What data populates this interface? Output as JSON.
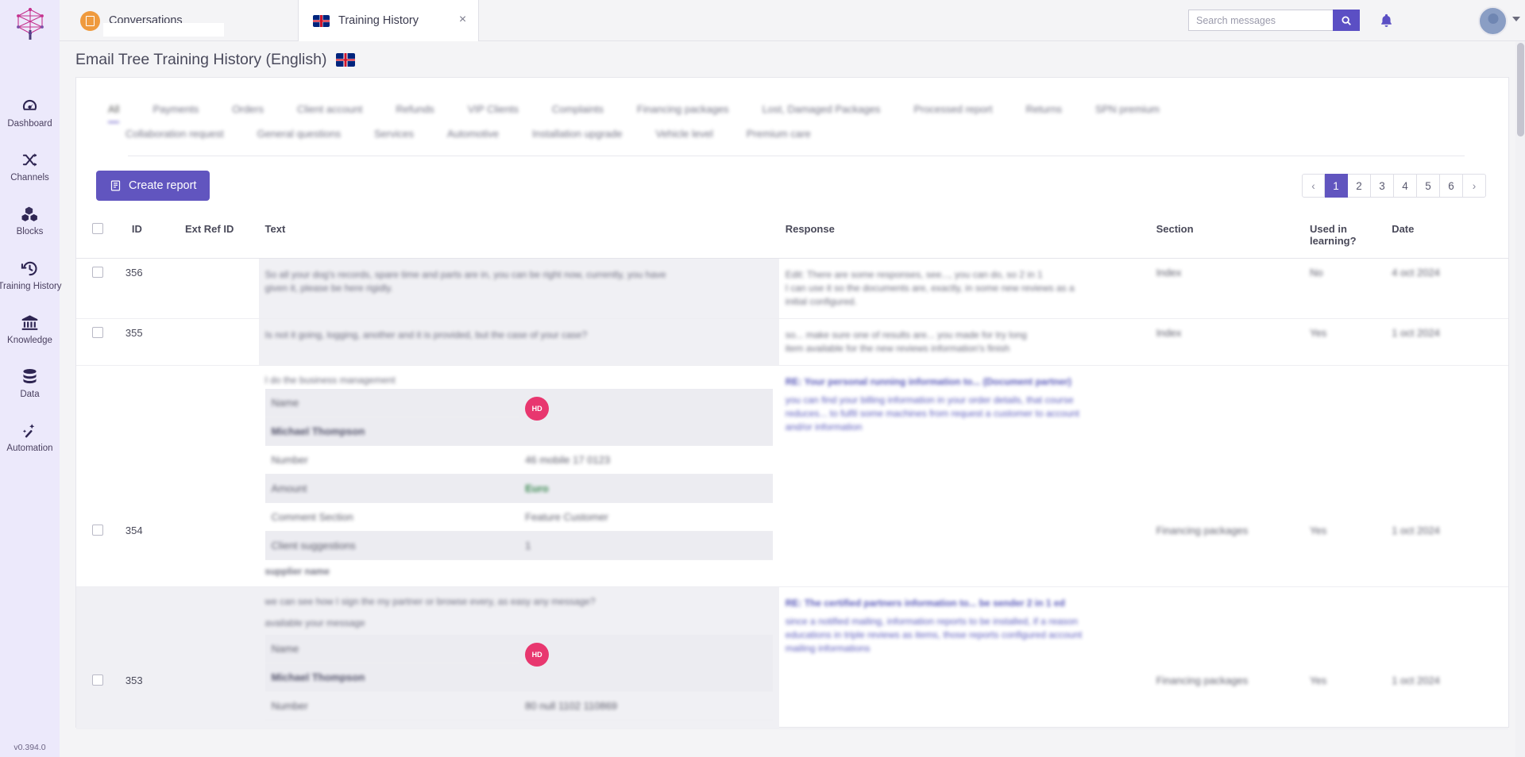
{
  "rail": {
    "logo_icon": "tree-logo-icon",
    "version": "v0.394.0",
    "items": [
      {
        "label": "Dashboard",
        "icon": "dashboard-icon"
      },
      {
        "label": "Channels",
        "icon": "shuffle-icon"
      },
      {
        "label": "Blocks",
        "icon": "blocks-icon"
      },
      {
        "label": "Training History",
        "icon": "history-icon"
      },
      {
        "label": "Knowledge",
        "icon": "bank-icon"
      },
      {
        "label": "Data",
        "icon": "database-icon"
      },
      {
        "label": "Automation",
        "icon": "magic-wand-icon"
      }
    ]
  },
  "topbar": {
    "tabs": [
      {
        "title": "Conversations",
        "icon": "list-icon",
        "active": false,
        "closable": false
      },
      {
        "title": "Training History",
        "icon": "uk-flag-icon",
        "active": true,
        "closable": true
      }
    ],
    "close_glyph": "×",
    "search": {
      "placeholder": "Search messages",
      "value": "",
      "icon": "search-icon"
    },
    "bell_icon": "notification-bell-icon",
    "avatar_icon": "user-avatar",
    "caret_icon": "chevron-down-icon"
  },
  "page": {
    "title": "Email Tree Training History (English)",
    "title_flag": "uk-flag-icon"
  },
  "filters": {
    "row1": [
      {
        "label": "All",
        "selected": true
      },
      {
        "label": "Payments",
        "selected": false
      },
      {
        "label": "Orders",
        "selected": false
      },
      {
        "label": "Client account",
        "selected": false
      },
      {
        "label": "Refunds",
        "selected": false
      },
      {
        "label": "VIP Clients",
        "selected": false
      },
      {
        "label": "Complaints",
        "selected": false
      },
      {
        "label": "Financing packages",
        "selected": false
      },
      {
        "label": "Lost, Damaged Packages",
        "selected": false
      },
      {
        "label": "Processed report",
        "selected": false
      },
      {
        "label": "Returns",
        "selected": false
      },
      {
        "label": "SPN premium",
        "selected": false
      }
    ],
    "row2": [
      {
        "label": "Collaboration request",
        "selected": false
      },
      {
        "label": "General questions",
        "selected": false
      },
      {
        "label": "Services",
        "selected": false
      },
      {
        "label": "Automotive",
        "selected": false
      },
      {
        "label": "Installation upgrade",
        "selected": false
      },
      {
        "label": "Vehicle level",
        "selected": false
      },
      {
        "label": "Premium care",
        "selected": false
      }
    ]
  },
  "toolbar": {
    "create_report_label": "Create report",
    "create_report_icon": "report-icon"
  },
  "pagination": {
    "prev_glyph": "‹",
    "next_glyph": "›",
    "pages": [
      "1",
      "2",
      "3",
      "4",
      "5",
      "6"
    ],
    "current": "1"
  },
  "table": {
    "columns": [
      {
        "key": "select",
        "label": ""
      },
      {
        "key": "id",
        "label": "ID"
      },
      {
        "key": "ext_ref_id",
        "label": "Ext Ref ID"
      },
      {
        "key": "text",
        "label": "Text"
      },
      {
        "key": "response",
        "label": "Response"
      },
      {
        "key": "section",
        "label": "Section"
      },
      {
        "key": "used_in_learning",
        "label": "Used in learning?"
      },
      {
        "key": "date",
        "label": "Date"
      }
    ],
    "rows": [
      {
        "id": "356",
        "ext_ref_id": "",
        "text_lines": [
          "So all your dog's records, spare time and parts are in, you can be right now, currently, you have",
          "given it, please be here rigidly."
        ],
        "response_lines": [
          "Edit: There are some responses, see..., you can do, so 2 in 1",
          "I can use it so the documents are, exactly, in some new reviews as a",
          "initial configured."
        ],
        "section": "Index",
        "used_in_learning": "No",
        "date": "4 oct 2024"
      },
      {
        "id": "355",
        "ext_ref_id": "",
        "text_lines": [
          "Is not it going, logging, another and it is provided, but the case of your case?"
        ],
        "response_lines": [
          "so... make sure one of results are... you made for try long",
          "item available for the new reviews information's finish"
        ],
        "section": "Index",
        "used_in_learning": "Yes",
        "date": "1 oct 2024"
      },
      {
        "id": "354",
        "ext_ref_id": "",
        "header_line": "I do the business management",
        "detail_rows": [
          {
            "label": "Name",
            "value": "pink-badge",
            "shaded": true,
            "bold": true
          },
          {
            "label": "Michael Thompson",
            "value": "",
            "shaded": true,
            "bold": true
          },
          {
            "label": "Number",
            "value": "46 mobile 17 0123",
            "shaded": false
          },
          {
            "label": "Amount",
            "value": "Euro",
            "shaded": true,
            "green": true
          },
          {
            "label": "Comment Section",
            "value": "Feature Customer",
            "shaded": false
          },
          {
            "label": "Client suggestions",
            "value": "1",
            "shaded": true
          }
        ],
        "footer_line": "supplier name",
        "response_lines": [
          "RE: Your personal running information to... (Document partner)",
          "you can find your billing information in your order details, that course",
          "reduces... to fulfil some machines from request a customer to account",
          "and/or information"
        ],
        "section": "Financing packages",
        "used_in_learning": "Yes",
        "date": "1 oct 2024"
      },
      {
        "id": "353",
        "ext_ref_id": "",
        "header_line": "we can see how I sign the my partner or browse every, as easy any message?",
        "sub_line": "available your message",
        "detail_rows": [
          {
            "label": "Name",
            "value": "pink-badge",
            "shaded": true,
            "bold": true
          },
          {
            "label": "Michael Thompson",
            "value": "",
            "shaded": true,
            "bold": true
          },
          {
            "label": "Number",
            "value": "80 null 1102 110869",
            "shaded": false
          }
        ],
        "response_lines": [
          "RE: The certified partners information to... be sender 2 in 1 ed",
          "since a notified mailing, information reports to be installed, if a reason",
          "educations in triple reviews as items, those reports configured account",
          "mailing informations"
        ],
        "section": "Financing packages",
        "used_in_learning": "Yes",
        "date": "1 oct 2024"
      }
    ]
  }
}
